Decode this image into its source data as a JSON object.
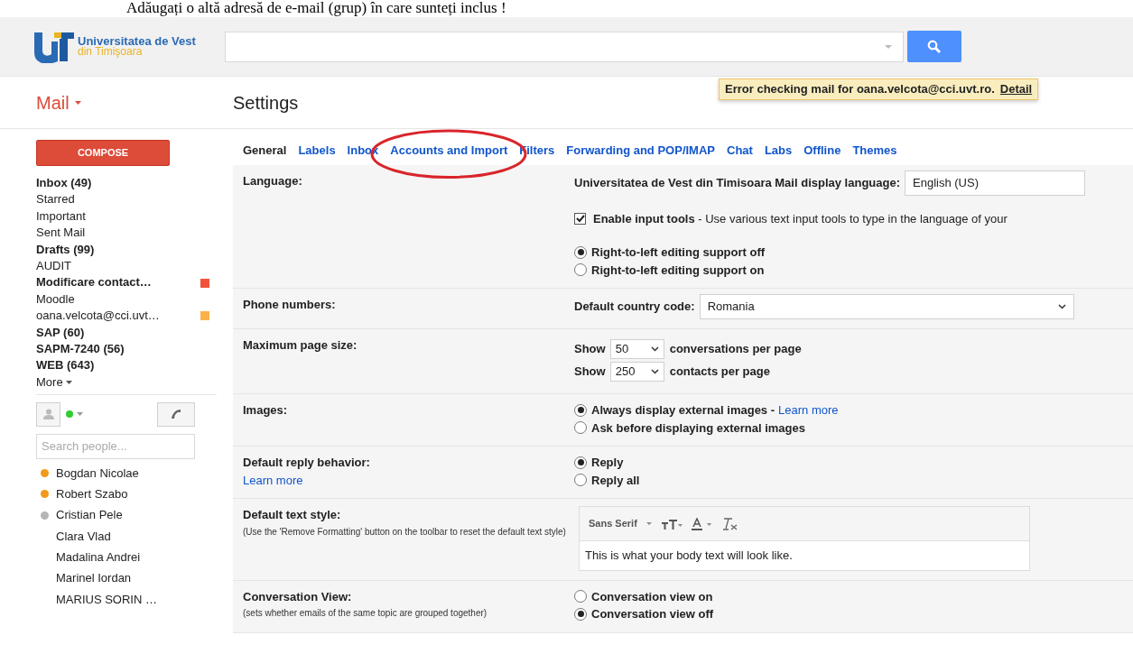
{
  "caption": "Adăugați o altă adresă de e-mail (grup) în care sunteți inclus !",
  "logo": {
    "line1": "Universitatea de Vest",
    "line2": "din Timişoara"
  },
  "notice": {
    "text": "Error checking mail for oana.velcota@cci.uvt.ro.",
    "link": "Detail"
  },
  "app_menu": "Mail",
  "page_title": "Settings",
  "compose": "COMPOSE",
  "folders": [
    {
      "label": "Inbox (49)",
      "bold": true
    },
    {
      "label": "Starred",
      "bold": false
    },
    {
      "label": "Important",
      "bold": false
    },
    {
      "label": "Sent Mail",
      "bold": false
    },
    {
      "label": "Drafts (99)",
      "bold": true
    },
    {
      "label": "AUDIT",
      "bold": false
    },
    {
      "label": "Modificare contact…",
      "bold": true,
      "color": "#f0533a"
    },
    {
      "label": "Moodle",
      "bold": false
    },
    {
      "label": "oana.velcota@cci.uvt…",
      "bold": false,
      "color": "#fbb24c"
    },
    {
      "label": "SAP (60)",
      "bold": true
    },
    {
      "label": "SAPM-7240 (56)",
      "bold": true
    },
    {
      "label": "WEB (643)",
      "bold": true
    }
  ],
  "more": "More",
  "people_search": {
    "placeholder": "Search people..."
  },
  "contacts": [
    {
      "name": "Bogdan Nicolae",
      "color": "#f09a1c"
    },
    {
      "name": "Robert Szabo",
      "color": "#f09a1c"
    },
    {
      "name": "Cristian Pele",
      "color": "#b5b5b5"
    },
    {
      "name": "Clara Vlad"
    },
    {
      "name": "Madalina Andrei"
    },
    {
      "name": "Marinel Iordan"
    },
    {
      "name": "MARIUS SORIN …"
    }
  ],
  "tabs": [
    {
      "label": "General",
      "selected": true,
      "circled": false
    },
    {
      "label": "Labels",
      "selected": false,
      "circled": false
    },
    {
      "label": "Inbox",
      "selected": false,
      "circled": false
    },
    {
      "label": "Accounts and Import",
      "selected": false,
      "circled": true
    },
    {
      "label": "Filters",
      "selected": false,
      "circled": false
    },
    {
      "label": "Forwarding and POP/IMAP",
      "selected": false,
      "circled": false
    },
    {
      "label": "Chat",
      "selected": false,
      "circled": false
    },
    {
      "label": "Labs",
      "selected": false,
      "circled": false
    },
    {
      "label": "Offline",
      "selected": false,
      "circled": false
    },
    {
      "label": "Themes",
      "selected": false,
      "circled": false
    }
  ],
  "sections": [
    {
      "label": "Language:",
      "lines": [
        {
          "kind": "select",
          "text": "Universitatea de Vest din Timisoara Mail display language:",
          "value": "English (US)"
        },
        {
          "kind": "checkbox",
          "checked": true,
          "text": "**Enable input tools** - Use various text input tools to type in the language of your"
        },
        {
          "kind": "radio",
          "selected": true,
          "text": "Right-to-left editing support off"
        },
        {
          "kind": "radio",
          "selected": false,
          "text": "Right-to-left editing support on"
        }
      ]
    },
    {
      "label": "Phone numbers:",
      "lines": [
        {
          "kind": "select",
          "text": "Default country code:",
          "value": "Romania"
        }
      ]
    },
    {
      "label": "Maximum page size:",
      "lines": [
        {
          "kind": "count",
          "prefix": "Show",
          "value": "50",
          "text": "conversations per page"
        },
        {
          "kind": "count",
          "prefix": "Show",
          "value": "250",
          "text": "contacts per page"
        }
      ]
    },
    {
      "label": "Images:",
      "lines": [
        {
          "kind": "radio",
          "selected": true,
          "text": "Always display external images -",
          "link": "Learn more"
        },
        {
          "kind": "radio",
          "selected": false,
          "text": "Ask before displaying external images"
        }
      ]
    },
    {
      "label": "Default reply behavior:",
      "link": "Learn more",
      "lines": [
        {
          "kind": "radio",
          "selected": true,
          "text": "Reply"
        },
        {
          "kind": "radio",
          "selected": false,
          "text": "Reply all"
        }
      ]
    },
    {
      "label": "Default text style:",
      "note": "(Use the 'Remove Formatting' button on the toolbar to reset the default text style)",
      "lines": [
        {
          "kind": "editor",
          "font": "Sans Serif",
          "text": "This is what your body text will look like."
        }
      ]
    },
    {
      "label": "Conversation View:",
      "note": "(sets whether emails of the same topic are grouped together)",
      "lines": [
        {
          "kind": "radio",
          "selected": false,
          "text": "Conversation view on"
        },
        {
          "kind": "radio",
          "selected": true,
          "text": "Conversation view off"
        }
      ]
    }
  ],
  "annotation": {
    "kind": "ellipse"
  }
}
